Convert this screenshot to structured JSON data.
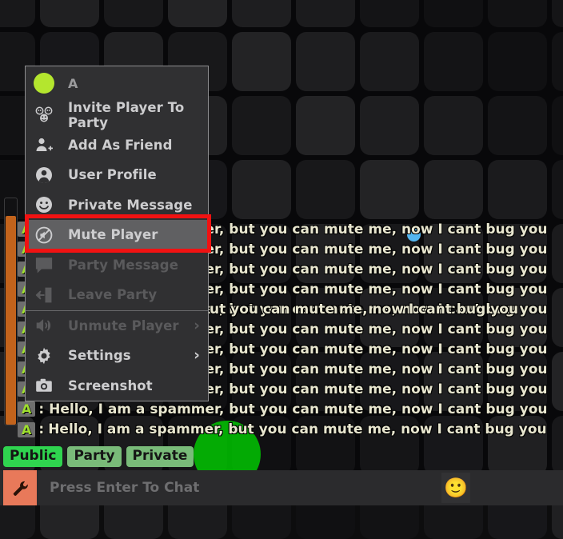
{
  "background": {
    "tile_color_base": "#18181a",
    "page_color": "#08080a",
    "blue_dot_color": "#54b6f0",
    "green_blob_color": "#00d600"
  },
  "context_menu": {
    "header": {
      "player_name": "A",
      "status_dot_color": "#b4e62e"
    },
    "items": [
      {
        "label": "Invite Player To Party",
        "icon": "three-faces-icon",
        "enabled": true,
        "submenu": false,
        "highlighted": false
      },
      {
        "label": "Add As Friend",
        "icon": "add-friend-icon",
        "enabled": true,
        "submenu": false,
        "highlighted": false
      },
      {
        "label": "User Profile",
        "icon": "user-circle-icon",
        "enabled": true,
        "submenu": false,
        "highlighted": false
      },
      {
        "label": "Private Message",
        "icon": "smiley-icon",
        "enabled": true,
        "submenu": false,
        "highlighted": false
      },
      {
        "label": "Mute Player",
        "icon": "mute-icon",
        "enabled": true,
        "submenu": false,
        "highlighted": true
      },
      {
        "label": "Party Message",
        "icon": "speech-bubble-icon",
        "enabled": false,
        "submenu": false,
        "highlighted": false
      },
      {
        "label": "Leave Party",
        "icon": "exit-door-icon",
        "enabled": false,
        "submenu": false,
        "highlighted": false
      },
      {
        "label": "Unmute Player",
        "icon": "speaker-icon",
        "enabled": false,
        "submenu": true,
        "highlighted": false
      },
      {
        "label": "Settings",
        "icon": "gear-icon",
        "enabled": true,
        "submenu": true,
        "highlighted": false
      },
      {
        "label": "Screenshot",
        "icon": "camera-icon",
        "enabled": true,
        "submenu": false,
        "highlighted": false
      }
    ],
    "submenu_arrow_glyph": "›",
    "highlight_box_color": "#f11212"
  },
  "chat": {
    "badge_label": "A",
    "separator": ":",
    "message": "Hello, I am a spammer, but you can mute me, now I cant bug you",
    "history_message": "ut you can mute me, now I cant bug you",
    "tabs": [
      {
        "label": "Public",
        "active": true
      },
      {
        "label": "Party",
        "active": false
      },
      {
        "label": "Private",
        "active": false
      }
    ],
    "input_placeholder": "Press Enter To Chat",
    "emoji_button_glyph": "🙂",
    "wrench_icon": "wrench-icon",
    "scrollbar_thumb_color": "#c2631c"
  }
}
